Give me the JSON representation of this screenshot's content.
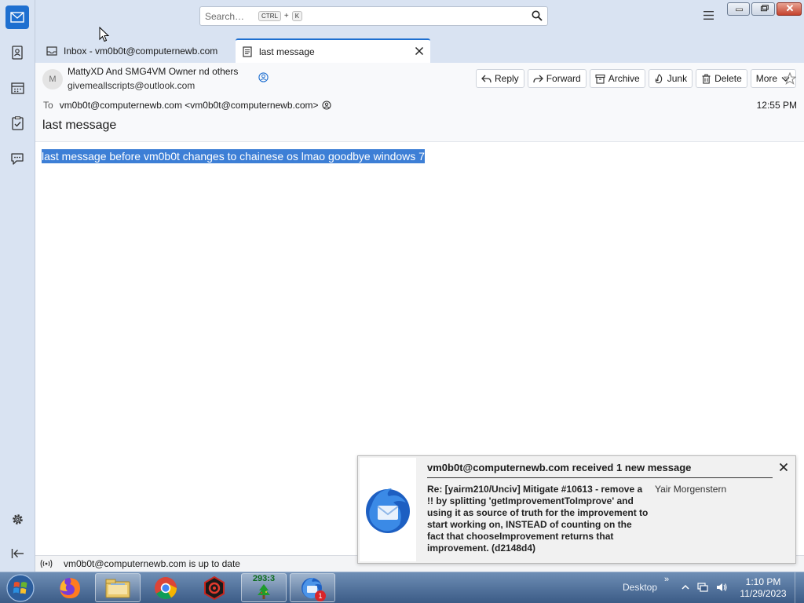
{
  "search": {
    "placeholder": "Search…",
    "shortcut_key1": "CTRL",
    "shortcut_plus": "+",
    "shortcut_key2": "K"
  },
  "tabs": [
    {
      "label": "Inbox - vm0b0t@computernewb.com"
    },
    {
      "label": "last message"
    }
  ],
  "message": {
    "avatar_initial": "M",
    "from_name": "MattyXD And SMG4VM Owner nd others",
    "from_addr": "givemeallscripts@outlook.com",
    "to_label": "To",
    "to_value": "vm0b0t@computernewb.com <vm0b0t@computernewb.com>",
    "time": "12:55 PM",
    "subject": "last message",
    "body": "last message before vm0b0t changes to chainese os lmao goodbye windows 7"
  },
  "actions": {
    "reply": "Reply",
    "forward": "Forward",
    "archive": "Archive",
    "junk": "Junk",
    "delete": "Delete",
    "more": "More"
  },
  "status": {
    "text": "vm0b0t@computernewb.com is up to date"
  },
  "notification": {
    "title": "vm0b0t@computernewb.com received 1 new message",
    "subject": "Re: [yairm210/Unciv] Mitigate #10613 - remove a !! by splitting 'getImprovementToImprove' and using it as source of truth for the improvement to start working on, INSTEAD of counting on the fact that chooseImprovement returns that improvement. (d2148d4)",
    "author": "Yair Morgenstern"
  },
  "taskbar": {
    "tree_counter": "293:3",
    "thunderbird_badge": "1",
    "desktop_label": "Desktop",
    "chevrons": "»",
    "clock_time": "1:10 PM",
    "clock_date": "11/29/2023"
  },
  "colors": {
    "accent": "#1e6fd0",
    "selection": "#3d7fd6",
    "chrome": "#d9e3f2"
  }
}
